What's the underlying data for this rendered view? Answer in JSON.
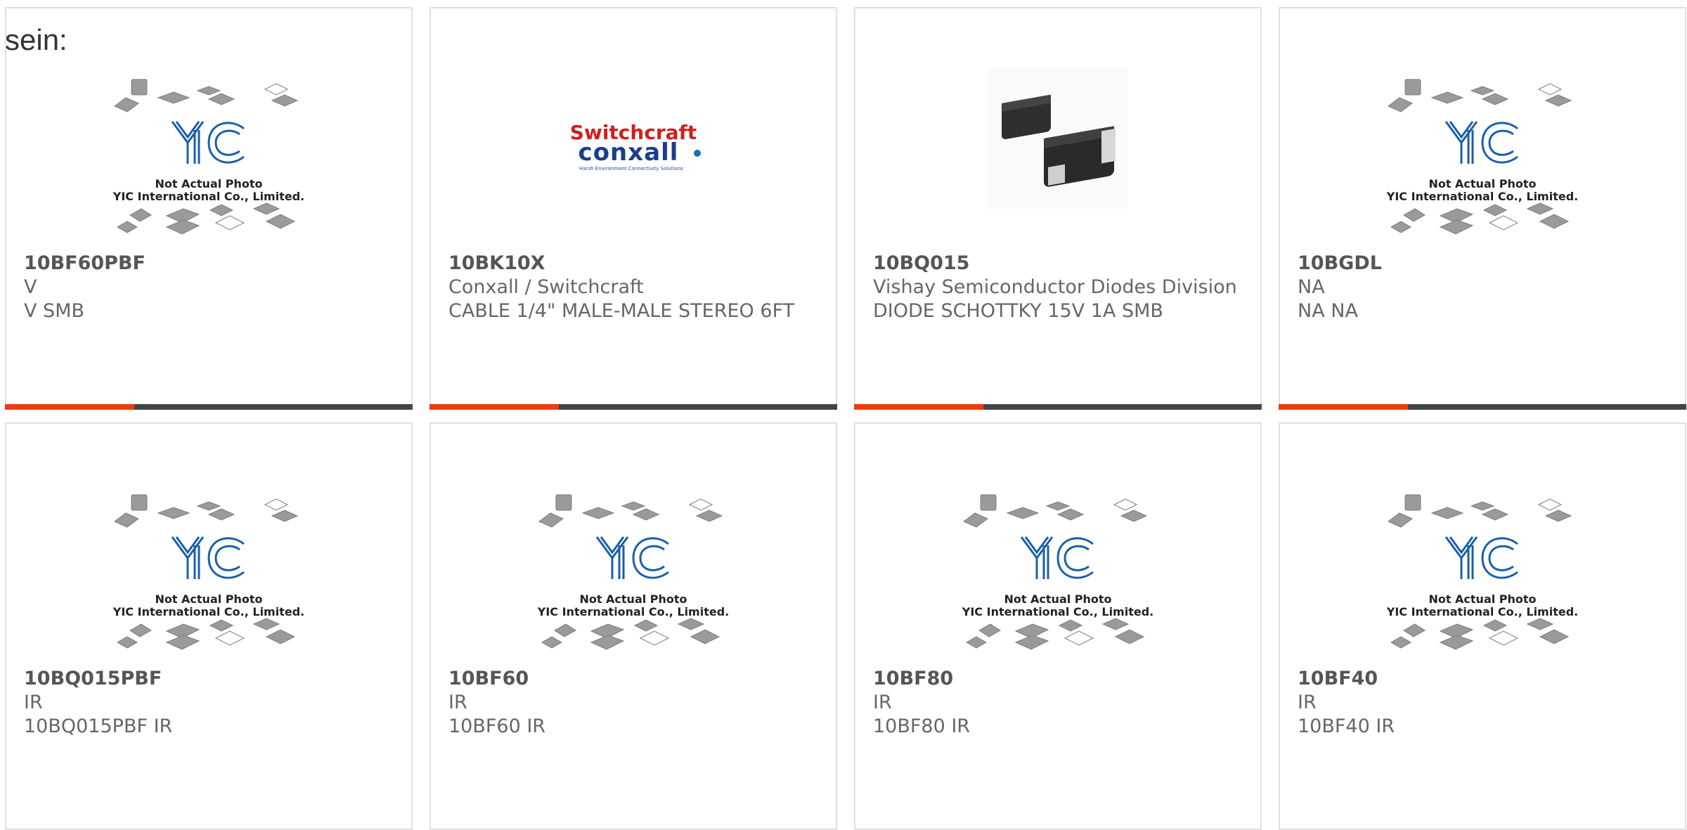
{
  "intro_text": "sein:",
  "placeholder": {
    "caption_line1": "Not Actual Photo",
    "caption_line2": "YIC International Co., Limited.",
    "logo_text": "YIC"
  },
  "switchcraft_logo": {
    "top": "Switchcraft",
    "bottom": "conxall",
    "tagline": "Harsh Environment Connectivity Solutions"
  },
  "colors": {
    "accent": "#ee3b12",
    "bar": "#444444",
    "border": "#e0e0e0",
    "logo_blue": "#1a5fa8"
  },
  "products": [
    {
      "part": "10BF60PBF",
      "manufacturer": "V",
      "description": "V SMB",
      "image": "yic-placeholder"
    },
    {
      "part": "10BK10X",
      "manufacturer": "Conxall / Switchcraft",
      "description": "CABLE 1/4\" MALE-MALE STEREO 6FT",
      "image": "switchcraft-logo"
    },
    {
      "part": "10BQ015",
      "manufacturer": "Vishay Semiconductor Diodes Division",
      "description": "DIODE SCHOTTKY 15V 1A SMB",
      "image": "smb-diode-photo"
    },
    {
      "part": "10BGDL",
      "manufacturer": "NA",
      "description": "NA NA",
      "image": "yic-placeholder"
    },
    {
      "part": "10BQ015PBF",
      "manufacturer": "IR",
      "description": "10BQ015PBF IR",
      "image": "yic-placeholder"
    },
    {
      "part": "10BF60",
      "manufacturer": "IR",
      "description": "10BF60 IR",
      "image": "yic-placeholder"
    },
    {
      "part": "10BF80",
      "manufacturer": "IR",
      "description": "10BF80 IR",
      "image": "yic-placeholder"
    },
    {
      "part": "10BF40",
      "manufacturer": "IR",
      "description": "10BF40 IR",
      "image": "yic-placeholder"
    }
  ]
}
